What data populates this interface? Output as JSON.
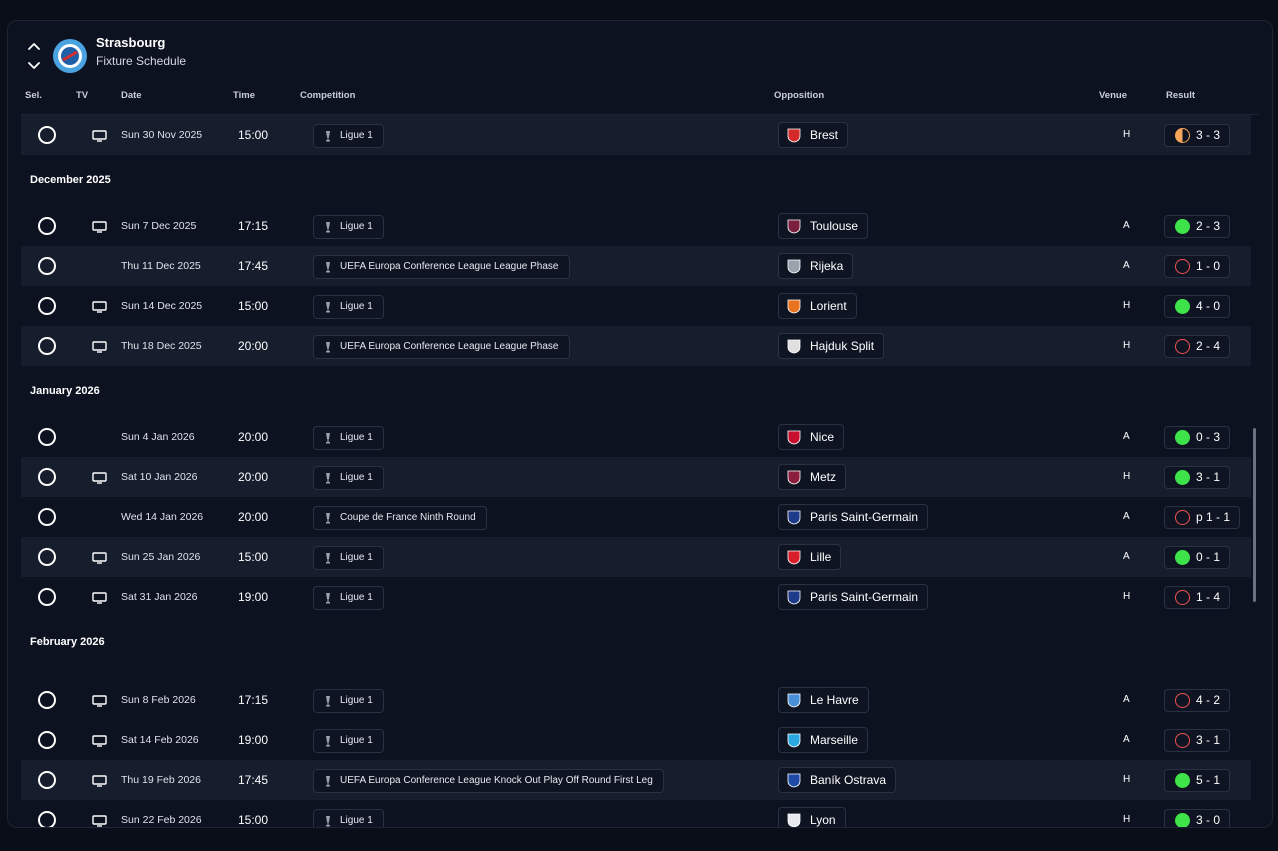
{
  "header": {
    "club_name": "Strasbourg",
    "subtitle": "Fixture Schedule"
  },
  "columns": {
    "sel": "Sel.",
    "tv": "TV",
    "date": "Date",
    "time": "Time",
    "competition": "Competition",
    "opposition": "Opposition",
    "venue": "Venue",
    "result": "Result"
  },
  "colors": {
    "win": "#3ee34a",
    "loss": "#f05252",
    "draw": "#f6a45a",
    "background": "#0d1220",
    "alt_row": "#161d2c"
  },
  "months": [
    "December 2025",
    "January 2026",
    "February 2026"
  ],
  "fixtures": [
    {
      "tv": true,
      "date": "Sun 30 Nov 2025",
      "time": "15:00",
      "competition": "Ligue 1",
      "opponent": "Brest",
      "crest": "brest-crest",
      "venue": "H",
      "result": "3 - 3",
      "outcome": "draw"
    },
    {
      "tv": true,
      "date": "Sun 7 Dec 2025",
      "time": "17:15",
      "competition": "Ligue 1",
      "opponent": "Toulouse",
      "crest": "toulouse-crest",
      "venue": "A",
      "result": "2 - 3",
      "outcome": "win"
    },
    {
      "tv": false,
      "date": "Thu 11 Dec 2025",
      "time": "17:45",
      "competition": "UEFA Europa Conference League League Phase",
      "opponent": "Rijeka",
      "crest": "rijeka-crest",
      "venue": "A",
      "result": "1 - 0",
      "outcome": "loss"
    },
    {
      "tv": true,
      "date": "Sun 14 Dec 2025",
      "time": "15:00",
      "competition": "Ligue 1",
      "opponent": "Lorient",
      "crest": "lorient-crest",
      "venue": "H",
      "result": "4 - 0",
      "outcome": "win"
    },
    {
      "tv": true,
      "date": "Thu 18 Dec 2025",
      "time": "20:00",
      "competition": "UEFA Europa Conference League League Phase",
      "opponent": "Hajduk Split",
      "crest": "hajduk-split-crest",
      "venue": "H",
      "result": "2 - 4",
      "outcome": "loss"
    },
    {
      "tv": false,
      "date": "Sun 4 Jan 2026",
      "time": "20:00",
      "competition": "Ligue 1",
      "opponent": "Nice",
      "crest": "nice-crest",
      "venue": "A",
      "result": "0 - 3",
      "outcome": "win"
    },
    {
      "tv": true,
      "date": "Sat 10 Jan 2026",
      "time": "20:00",
      "competition": "Ligue 1",
      "opponent": "Metz",
      "crest": "metz-crest",
      "venue": "H",
      "result": "3 - 1",
      "outcome": "win"
    },
    {
      "tv": false,
      "date": "Wed 14 Jan 2026",
      "time": "20:00",
      "competition": "Coupe de France Ninth Round",
      "opponent": "Paris Saint-Germain",
      "crest": "psg-crest",
      "venue": "A",
      "result": "p 1 - 1",
      "outcome": "loss"
    },
    {
      "tv": true,
      "date": "Sun 25 Jan 2026",
      "time": "15:00",
      "competition": "Ligue 1",
      "opponent": "Lille",
      "crest": "lille-crest",
      "venue": "A",
      "result": "0 - 1",
      "outcome": "win"
    },
    {
      "tv": true,
      "date": "Sat 31 Jan 2026",
      "time": "19:00",
      "competition": "Ligue 1",
      "opponent": "Paris Saint-Germain",
      "crest": "psg-crest",
      "venue": "H",
      "result": "1 - 4",
      "outcome": "loss"
    },
    {
      "tv": true,
      "date": "Sun 8 Feb 2026",
      "time": "17:15",
      "competition": "Ligue 1",
      "opponent": "Le Havre",
      "crest": "le-havre-crest",
      "venue": "A",
      "result": "4 - 2",
      "outcome": "loss"
    },
    {
      "tv": true,
      "date": "Sat 14 Feb 2026",
      "time": "19:00",
      "competition": "Ligue 1",
      "opponent": "Marseille",
      "crest": "marseille-crest",
      "venue": "A",
      "result": "3 - 1",
      "outcome": "loss"
    },
    {
      "tv": true,
      "date": "Thu 19 Feb 2026",
      "time": "17:45",
      "competition": "UEFA Europa Conference League Knock Out Play Off Round First Leg",
      "opponent": "Baník Ostrava",
      "crest": "banik-ostrava-crest",
      "venue": "H",
      "result": "5 - 1",
      "outcome": "win"
    },
    {
      "tv": true,
      "date": "Sun 22 Feb 2026",
      "time": "15:00",
      "competition": "Ligue 1",
      "opponent": "Lyon",
      "crest": "lyon-crest",
      "venue": "H",
      "result": "3 - 0",
      "outcome": "win"
    }
  ]
}
